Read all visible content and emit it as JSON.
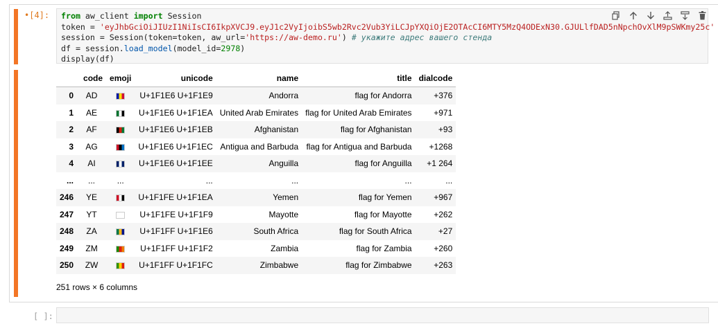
{
  "cell1": {
    "prompt": "[4]:",
    "code_lines": [
      [
        [
          "kw",
          "from"
        ],
        [
          "t",
          " aw_client "
        ],
        [
          "kw",
          "import"
        ],
        [
          "t",
          " Session"
        ]
      ],
      [
        [
          "t",
          "token = "
        ],
        [
          "str",
          "'eyJhbGciOiJIUzI1NiIsCI6IkpXVCJ9.eyJ1c2VyIjoibS5wb2Rvc2Vub3YiLCJpYXQiOjE2OTAcCI6MTY5MzQ4ODExN30.GJULlfDAD5nNpchOvXlM9pSWKmy25c'"
        ]
      ],
      [
        [
          "t",
          "session = Session(token=token, aw_url="
        ],
        [
          "str",
          "'https://aw-demo.ru'"
        ],
        [
          "t",
          ") "
        ],
        [
          "cm",
          "# укажите адрес вашего стенда"
        ]
      ],
      [
        [
          "t",
          "df = session."
        ],
        [
          "fn",
          "load_model"
        ],
        [
          "t",
          "(model_id="
        ],
        [
          "num",
          "2978"
        ],
        [
          "t",
          ")"
        ]
      ],
      [
        [
          "t",
          "display(df)"
        ]
      ]
    ],
    "toolbar_icons": [
      "copy-icon",
      "arrow-up-icon",
      "arrow-down-icon",
      "insert-above-icon",
      "insert-below-icon",
      "delete-icon"
    ]
  },
  "output": {
    "columns": [
      "",
      "code",
      "emoji",
      "unicode",
      "name",
      "title",
      "dialcode"
    ],
    "rows": [
      {
        "idx": "0",
        "code": "AD",
        "flag": [
          "#0018a8",
          "#fedf00",
          "#d0103a"
        ],
        "unicode": "U+1F1E6 U+1F1E9",
        "name": "Andorra",
        "title": "flag for Andorra",
        "dialcode": "+376"
      },
      {
        "idx": "1",
        "code": "AE",
        "flag": [
          "#00732f",
          "#ffffff",
          "#000000"
        ],
        "unicode": "U+1F1E6 U+1F1EA",
        "name": "United Arab Emirates",
        "title": "flag for United Arab Emirates",
        "dialcode": "+971"
      },
      {
        "idx": "2",
        "code": "AF",
        "flag": [
          "#000000",
          "#d32011",
          "#007a36"
        ],
        "unicode": "U+1F1E6 U+1F1EB",
        "name": "Afghanistan",
        "title": "flag for Afghanistan",
        "dialcode": "+93"
      },
      {
        "idx": "3",
        "code": "AG",
        "flag": [
          "#ce1126",
          "#000000",
          "#0072c6"
        ],
        "unicode": "U+1F1E6 U+1F1EC",
        "name": "Antigua and Barbuda",
        "title": "flag for Antigua and Barbuda",
        "dialcode": "+1268"
      },
      {
        "idx": "4",
        "code": "AI",
        "flag": [
          "#012169",
          "#ffffff",
          "#012169"
        ],
        "unicode": "U+1F1E6 U+1F1EE",
        "name": "Anguilla",
        "title": "flag for Anguilla",
        "dialcode": "+1 264"
      },
      {
        "idx": "...",
        "code": "...",
        "flag": [],
        "unicode": "...",
        "name": "...",
        "title": "...",
        "dialcode": "..."
      },
      {
        "idx": "246",
        "code": "YE",
        "flag": [
          "#ce1126",
          "#ffffff",
          "#000000"
        ],
        "unicode": "U+1F1FE U+1F1EA",
        "name": "Yemen",
        "title": "flag for Yemen",
        "dialcode": "+967"
      },
      {
        "idx": "247",
        "code": "YT",
        "flag": [
          "#ffffff",
          "#ffffff",
          "#ffffff"
        ],
        "unicode": "U+1F1FE U+1F1F9",
        "name": "Mayotte",
        "title": "flag for Mayotte",
        "dialcode": "+262"
      },
      {
        "idx": "248",
        "code": "ZA",
        "flag": [
          "#007749",
          "#ffb81c",
          "#001489"
        ],
        "unicode": "U+1F1FF U+1F1E6",
        "name": "South Africa",
        "title": "flag for South Africa",
        "dialcode": "+27"
      },
      {
        "idx": "249",
        "code": "ZM",
        "flag": [
          "#198a00",
          "#de2010",
          "#ef7d00"
        ],
        "unicode": "U+1F1FF U+1F1F2",
        "name": "Zambia",
        "title": "flag for Zambia",
        "dialcode": "+260"
      },
      {
        "idx": "250",
        "code": "ZW",
        "flag": [
          "#319208",
          "#ffd200",
          "#de2010"
        ],
        "unicode": "U+1F1FF U+1F1FC",
        "name": "Zimbabwe",
        "title": "flag for Zimbabwe",
        "dialcode": "+263"
      }
    ],
    "summary": "251 rows × 6 columns"
  },
  "cell2": {
    "prompt": "[ ]:"
  },
  "colors": {
    "accent": "#f37626",
    "editor_bg": "#f6f6f6"
  }
}
